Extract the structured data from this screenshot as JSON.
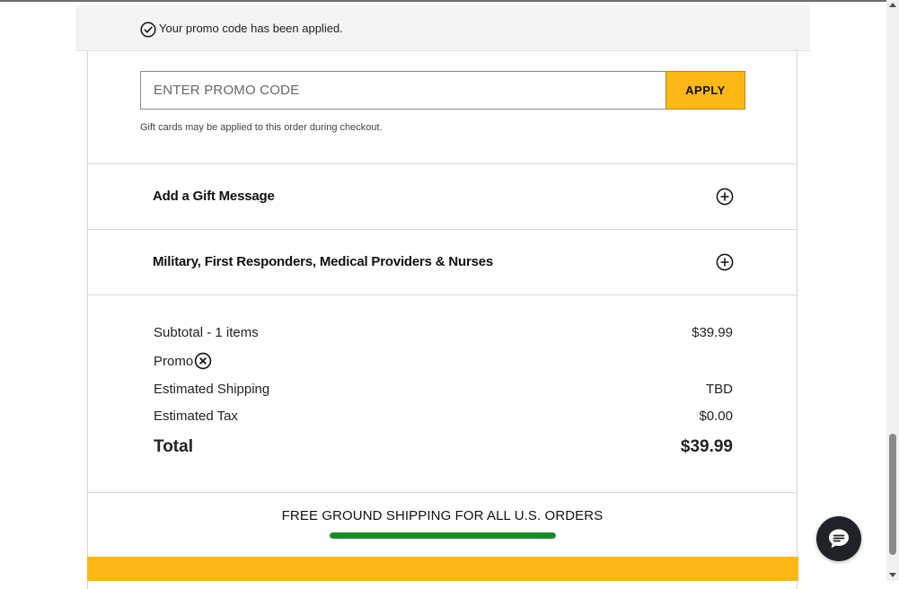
{
  "banner": {
    "message": "Your promo code has been applied.",
    "icon": "check-circle-icon"
  },
  "promo": {
    "placeholder": "ENTER PROMO CODE",
    "apply_label": "APPLY",
    "note": "Gift cards may be applied to this order during checkout."
  },
  "accordions": [
    {
      "label": "Add a Gift Message",
      "icon": "plus-circle-icon"
    },
    {
      "label": "Military, First Responders, Medical Providers & Nurses",
      "icon": "plus-circle-icon"
    }
  ],
  "summary": {
    "subtotal_label": "Subtotal - 1 items",
    "subtotal_value": "$39.99",
    "promo_label": "Promo",
    "shipping_label": "Estimated Shipping",
    "shipping_value": "TBD",
    "tax_label": "Estimated Tax",
    "tax_value": "$0.00",
    "total_label": "Total",
    "total_value": "$39.99"
  },
  "free_shipping": {
    "message": "FREE GROUND SHIPPING FOR ALL U.S. ORDERS",
    "progress_percent": 100
  },
  "colors": {
    "accent": "#fdb717",
    "progress": "#1d8a2a",
    "chat": "#1f2328"
  },
  "chat": {
    "icon": "chat-bubble-icon"
  }
}
